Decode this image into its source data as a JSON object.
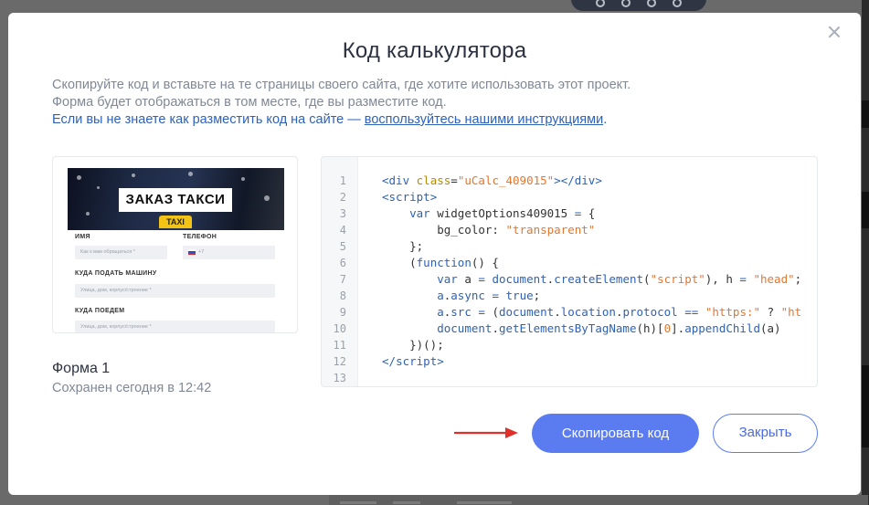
{
  "modal": {
    "title": "Код калькулятора",
    "desc_line1": "Скопируйте код и вставьте на те страницы своего сайта, где хотите использовать этот проект.",
    "desc_line2": "Форма будет отображаться в том месте, где вы разместите код.",
    "desc_line3_text": "Если вы не знаете как разместить код на сайте — ",
    "desc_line3_link": "воспользуйтесь нашими инструкциями",
    "desc_line3_end": "."
  },
  "preview": {
    "hero_title": "ЗАКАЗ ТАКСИ",
    "taxi_sign": "TAXI",
    "label_name": "ИМЯ",
    "label_phone": "ТЕЛЕФОН",
    "placeholder_name": "Как к вам обращаться *",
    "phone_prefix": "+7",
    "label_pickup": "КУДА ПОДАТЬ МАШИНУ",
    "placeholder_pickup": "Улица, дом, корпус/строение *",
    "label_dest": "КУДА ПОЕДЕМ",
    "placeholder_dest": "Улица, дом, корпус/строение *"
  },
  "form": {
    "name": "Форма 1",
    "saved": "Сохранен сегодня в 12:42"
  },
  "code": {
    "line_numbers": [
      "1",
      "2",
      "3",
      "4",
      "5",
      "6",
      "7",
      "8",
      "9",
      "10",
      "11",
      "12",
      "13"
    ]
  },
  "buttons": {
    "copy": "Скопировать код",
    "close": "Закрыть"
  },
  "colors": {
    "primary": "#5b7cf0",
    "link": "#2d62b8",
    "arrow": "#e0302a"
  }
}
